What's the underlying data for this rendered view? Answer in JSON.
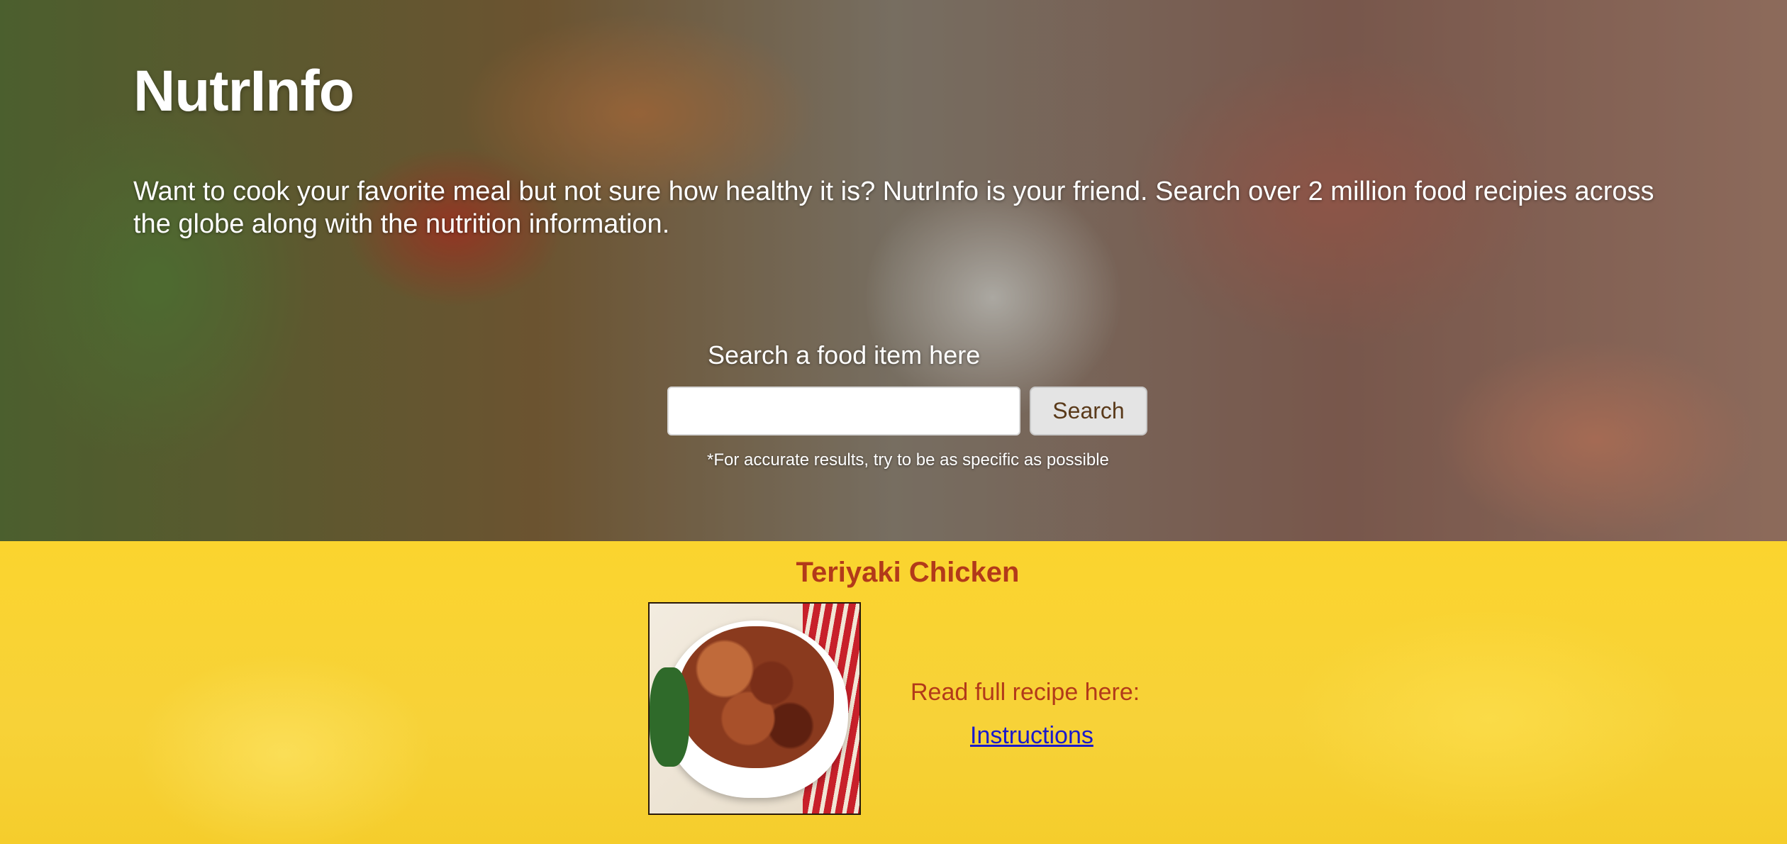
{
  "header": {
    "brand": "NutrInfo",
    "tagline": "Want to cook your favorite meal but not sure how healthy it is? NutrInfo is your friend. Search over 2 million food recipies across the globe along with the nutrition information."
  },
  "search": {
    "label": "Search a food item here",
    "value": "",
    "placeholder": "",
    "button_label": "Search",
    "hint": "*For accurate results, try to be as specific as possible"
  },
  "result": {
    "title": "Teriyaki Chicken",
    "read_label": "Read full recipe here:",
    "link_text": "Instructions"
  },
  "colors": {
    "result_background": "#f8cf2a",
    "accent_text": "#b23a1a",
    "link": "#1a1acc"
  }
}
